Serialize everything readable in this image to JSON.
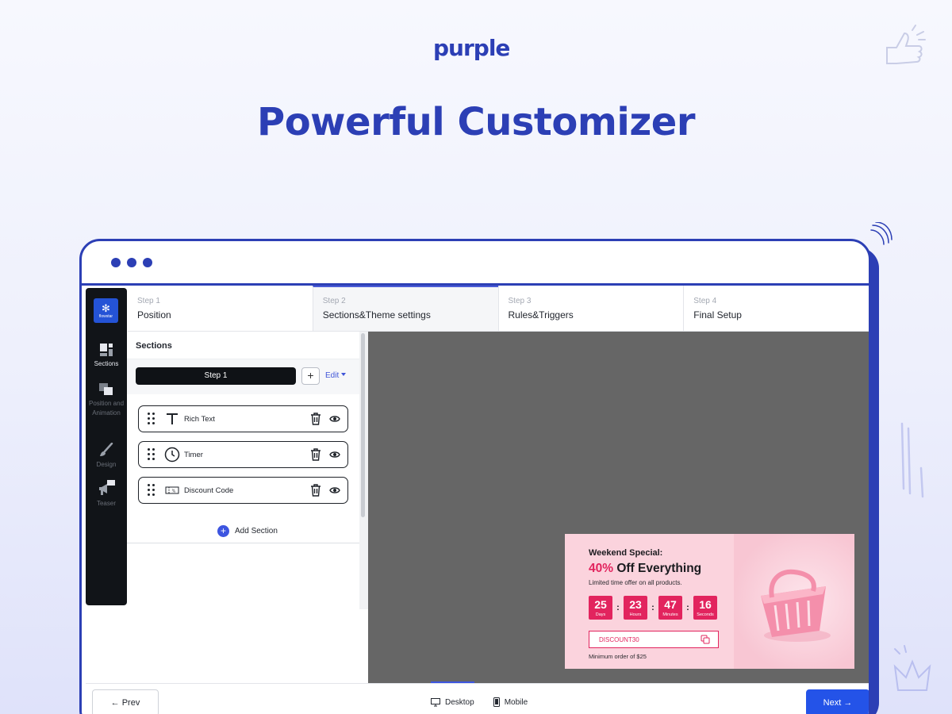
{
  "brand": {
    "logo_text": "purple"
  },
  "headline": "Powerful Customizer",
  "sidebar": {
    "badge_name": "flowstar",
    "items": [
      {
        "label": "Sections",
        "icon": "sections-icon",
        "active": true
      },
      {
        "label": "Position and Animation",
        "icon": "position-icon",
        "active": false
      },
      {
        "label": "Design",
        "icon": "brush-icon",
        "active": false
      },
      {
        "label": "Teaser",
        "icon": "megaphone-icon",
        "active": false
      }
    ]
  },
  "steps": [
    {
      "num": "Step 1",
      "name": "Position"
    },
    {
      "num": "Step 2",
      "name": "Sections&Theme settings",
      "active": true
    },
    {
      "num": "Step 3",
      "name": "Rules&Triggers"
    },
    {
      "num": "Step 4",
      "name": "Final Setup"
    }
  ],
  "panel": {
    "title": "Sections",
    "step_select": "Step 1",
    "plus": "+",
    "edit_label": "Edit",
    "sections": [
      {
        "label": "Rich Text",
        "icon": "text-icon"
      },
      {
        "label": "Timer",
        "icon": "clock-icon"
      },
      {
        "label": "Discount Code",
        "icon": "ticket-icon"
      }
    ],
    "add_section": "Add Section"
  },
  "promo": {
    "kicker": "Weekend Special:",
    "percent": "40%",
    "title_rest": " Off Everything",
    "subtitle": "Limited time offer on all products.",
    "countdown": [
      {
        "value": "25",
        "unit": "Days"
      },
      {
        "value": "23",
        "unit": "Hours"
      },
      {
        "value": "47",
        "unit": "Minutes"
      },
      {
        "value": "16",
        "unit": "Seconds"
      }
    ],
    "separator": ":",
    "code": "DISCOUNT30",
    "minimum": "Minimum order of $25",
    "accent_color": "#e2245e"
  },
  "footer": {
    "prev": "← Prev",
    "desktop": "Desktop",
    "mobile": "Mobile",
    "next": "Next →"
  },
  "colors": {
    "brand": "#2c3fb5",
    "primary_button": "#2453e8",
    "canvas": "#666666",
    "promo_bg": "#fbd3dd"
  }
}
